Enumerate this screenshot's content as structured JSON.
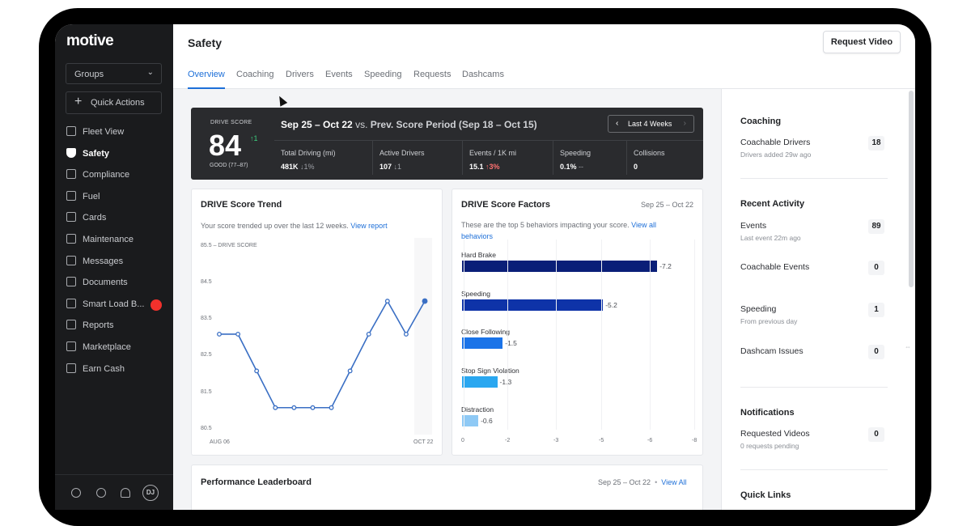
{
  "app": {
    "logo": "motive",
    "groups_label": "Groups",
    "quick_actions_label": "Quick Actions"
  },
  "sidebar": {
    "items": [
      {
        "label": "Fleet View",
        "icon": "map-icon"
      },
      {
        "label": "Safety",
        "icon": "shield-icon",
        "active": true
      },
      {
        "label": "Compliance",
        "icon": "document-icon"
      },
      {
        "label": "Fuel",
        "icon": "fuel-icon"
      },
      {
        "label": "Cards",
        "icon": "card-icon"
      },
      {
        "label": "Maintenance",
        "icon": "wrench-icon"
      },
      {
        "label": "Messages",
        "icon": "message-icon"
      },
      {
        "label": "Documents",
        "icon": "file-icon"
      },
      {
        "label": "Smart Load B...",
        "icon": "truck-icon",
        "badge": true
      },
      {
        "label": "Reports",
        "icon": "reports-icon"
      },
      {
        "label": "Marketplace",
        "icon": "marketplace-icon"
      },
      {
        "label": "Earn Cash",
        "icon": "dollar-icon"
      }
    ],
    "avatar_initials": "DJ",
    "badge_color": "#f2312c"
  },
  "header": {
    "title": "Safety",
    "request_video_label": "Request Video",
    "tabs": [
      "Overview",
      "Coaching",
      "Drivers",
      "Events",
      "Speeding",
      "Requests",
      "Dashcams"
    ],
    "active_tab": "Overview"
  },
  "scorebar": {
    "label": "DRIVE SCORE",
    "score": "84",
    "trend": "↑1",
    "rating": "GOOD (77–87)",
    "period": "Sep 25 – Oct 22",
    "vs": "vs.",
    "prev_period": "Prev. Score Period (Sep 18 – Oct 15)",
    "range_button": "Last 4 Weeks",
    "metrics": [
      {
        "label": "Total Driving (mi)",
        "value": "481K",
        "delta": "↓1%",
        "dir": "down"
      },
      {
        "label": "Active Drivers",
        "value": "107",
        "delta": "↓1",
        "dir": "down"
      },
      {
        "label": "Events / 1K mi",
        "value": "15.1",
        "delta": "↑3%",
        "dir": "up"
      },
      {
        "label": "Speeding",
        "value": "0.1%",
        "delta": "--",
        "dir": "down"
      },
      {
        "label": "Collisions",
        "value": "0",
        "delta": "",
        "dir": "none"
      }
    ]
  },
  "trend_card": {
    "title": "DRIVE Score Trend",
    "subtitle": "Your score trended up over the last 12 weeks.",
    "link": "View report",
    "y_label_top": "85.5 – DRIVE SCORE",
    "y_ticks": [
      "84.5",
      "83.5",
      "82.5",
      "81.5",
      "80.5"
    ],
    "x_start": "AUG 06",
    "x_end": "OCT 22"
  },
  "factors_card": {
    "title": "DRIVE Score Factors",
    "date": "Sep 25 – Oct 22",
    "subtitle": "These are the top 5 behaviors impacting your score.",
    "link": "View all behaviors",
    "axis_ticks": [
      "0",
      "-2",
      "-3",
      "-5",
      "-6",
      "-8"
    ]
  },
  "chart_data": [
    {
      "type": "line",
      "title": "DRIVE Score Trend",
      "ylabel": "DRIVE SCORE",
      "ylim": [
        80.5,
        85.5
      ],
      "x_labels": [
        "AUG 06",
        "OCT 22"
      ],
      "values": [
        83.1,
        83.1,
        82.1,
        81.1,
        81.1,
        81.1,
        81.1,
        82.1,
        83.1,
        84.0,
        83.1,
        84.0
      ],
      "color": "#3a6fc4"
    },
    {
      "type": "bar",
      "title": "DRIVE Score Factors",
      "categories": [
        "Hard Brake",
        "Speeding",
        "Close Following",
        "Stop Sign Violation",
        "Distraction"
      ],
      "values": [
        -7.2,
        -5.2,
        -1.5,
        -1.3,
        -0.6
      ],
      "colors": [
        "#0a1f78",
        "#0e33a8",
        "#1a73e8",
        "#2aa7f0",
        "#8ec9f5"
      ],
      "xlim": [
        0,
        -8
      ]
    }
  ],
  "leaderboard": {
    "title": "Performance Leaderboard",
    "date": "Sep 25 – Oct 22",
    "link": "View All"
  },
  "right_panel": {
    "coaching_title": "Coaching",
    "coachable_drivers_label": "Coachable Drivers",
    "coachable_drivers_sub": "Drivers added 29w ago",
    "coachable_drivers_value": "18",
    "recent_title": "Recent Activity",
    "events_label": "Events",
    "events_sub": "Last event 22m ago",
    "events_value": "89",
    "coachable_events_label": "Coachable Events",
    "coachable_events_value": "0",
    "speeding_label": "Speeding",
    "speeding_sub": "From previous day",
    "speeding_value": "1",
    "dashcam_label": "Dashcam Issues",
    "dashcam_value": "0",
    "notifications_title": "Notifications",
    "requested_label": "Requested Videos",
    "requested_sub": "0 requests pending",
    "requested_value": "0",
    "quick_links_title": "Quick Links"
  }
}
